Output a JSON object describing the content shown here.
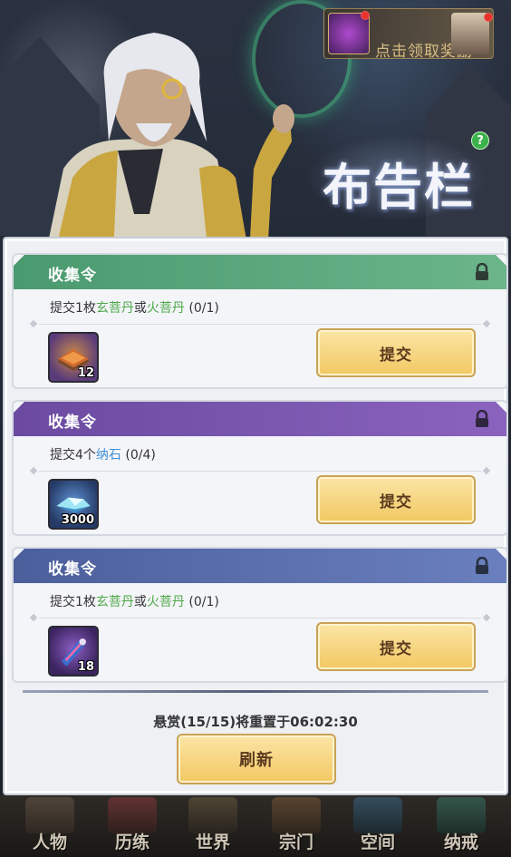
{
  "reward_notice": {
    "text": "点击领取奖励"
  },
  "title": "布告栏",
  "help_icon": "?",
  "cards": [
    {
      "theme": "green",
      "header": "收集令",
      "task_prefix": "提交1枚",
      "item_a": "玄菩丹",
      "joiner": "或",
      "item_b": "火菩丹",
      "progress": " (0/1)",
      "item_icon": "treasure-chest-icon",
      "item_qty": "12",
      "button_label": "提交"
    },
    {
      "theme": "purple",
      "header": "收集令",
      "task_prefix": "提交4个",
      "item_a": "纳石",
      "progress": " (0/4)",
      "item_icon": "crystal-stone-icon",
      "item_qty": "3000",
      "button_label": "提交"
    },
    {
      "theme": "blue",
      "header": "收集令",
      "task_prefix": "提交1枚",
      "item_a": "玄菩丹",
      "joiner": "或",
      "item_b": "火菩丹",
      "progress": " (0/1)",
      "item_icon": "scroll-item-icon",
      "item_qty": "18",
      "button_label": "提交"
    }
  ],
  "reset_status": "悬赏(15/15)将重置于06:02:30",
  "refresh_label": "刷新",
  "nav": [
    "人物",
    "历练",
    "世界",
    "宗门",
    "空间",
    "纳戒"
  ],
  "colors": {
    "green_header": "#4a9a6f",
    "purple_header": "#6b4aa0",
    "blue_header": "#4b5f9c",
    "button_gold": "#f2c862",
    "highlight_green": "#4da84a",
    "highlight_blue": "#3f8fd6"
  }
}
